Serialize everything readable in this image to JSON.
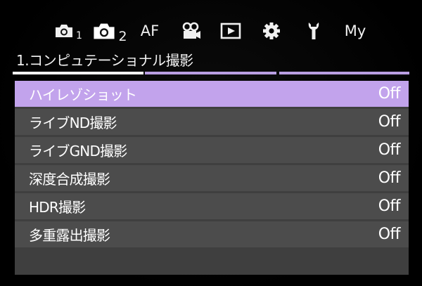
{
  "tabs": [
    {
      "id": "shooting-1",
      "icon": "camera-icon",
      "number": "1",
      "active": false
    },
    {
      "id": "shooting-2",
      "icon": "camera-icon",
      "number": "2",
      "active": true
    },
    {
      "id": "af",
      "label": "AF",
      "active": false
    },
    {
      "id": "video",
      "icon": "video-camera-icon",
      "active": false
    },
    {
      "id": "playback",
      "icon": "play-icon",
      "active": false
    },
    {
      "id": "setup",
      "icon": "gear-icon",
      "active": false
    },
    {
      "id": "custom",
      "icon": "wrench-icon",
      "active": false
    },
    {
      "id": "my-menu",
      "label": "My",
      "active": false
    }
  ],
  "page": {
    "title": "1.コンピュテーショナル撮影",
    "current_page": 1,
    "page_count": 3
  },
  "menu": {
    "selected_index": 0,
    "items": [
      {
        "label": "ハイレゾショット",
        "value": "Off"
      },
      {
        "label": "ライブND撮影",
        "value": "Off"
      },
      {
        "label": "ライブGND撮影",
        "value": "Off"
      },
      {
        "label": "深度合成撮影",
        "value": "Off"
      },
      {
        "label": "HDR撮影",
        "value": "Off"
      },
      {
        "label": "多重露出撮影",
        "value": "Off"
      }
    ]
  },
  "colors": {
    "background": "#000000",
    "row": "#4c4c4c",
    "row_selected": "#c2a3ec",
    "text": "#ffffff",
    "page_indicator_current": "#f2f2f2",
    "page_indicator_other": "#b99ee2"
  }
}
